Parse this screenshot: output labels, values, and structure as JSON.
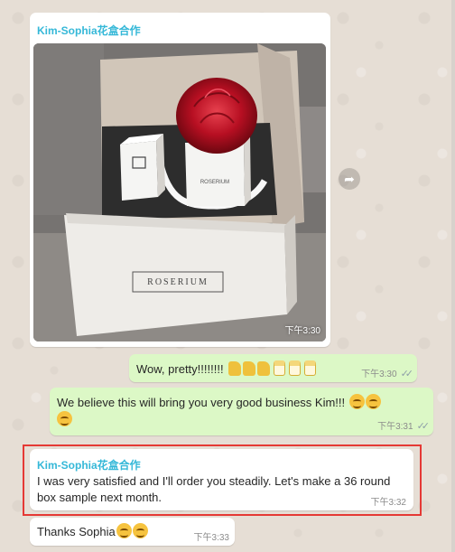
{
  "conversation": {
    "photo_message": {
      "sender": "Kim-Sophia花盒合作",
      "time": "下午3:30",
      "photo_box_brand": "ROSERIUM",
      "photo_label_line": "ROSERIUM"
    },
    "outgoing_1": {
      "text": "Wow, pretty!!!!!!!!",
      "emoji": [
        "thumbs-up",
        "thumbs-up",
        "thumbs-up",
        "cheers",
        "cheers",
        "cheers"
      ],
      "time": "下午3:30",
      "status": "read"
    },
    "outgoing_2": {
      "text": "We believe this will bring you very good business Kim!!!",
      "emoji": [
        "smiling-face",
        "smiling-face",
        "smiling-face"
      ],
      "time": "下午3:31",
      "status": "read"
    },
    "incoming_quote": {
      "sender": "Kim-Sophia花盒合作",
      "text": "I was very satisfied and I'll order you steadily. Let's make a 36 round box sample next month.",
      "time": "下午3:32"
    },
    "incoming_last": {
      "text": "Thanks Sophia",
      "emoji": [
        "smiling-face",
        "smiling-face"
      ],
      "time": "下午3:33"
    }
  },
  "colors": {
    "sender": "#35b8d8",
    "outgoing_bubble": "#dcf8c6",
    "incoming_bubble": "#ffffff",
    "highlight": "#e53935",
    "chat_background": "#e6ded5"
  },
  "icons": {
    "forward": "forward-arrow-icon",
    "read_receipt": "double-check-icon"
  }
}
